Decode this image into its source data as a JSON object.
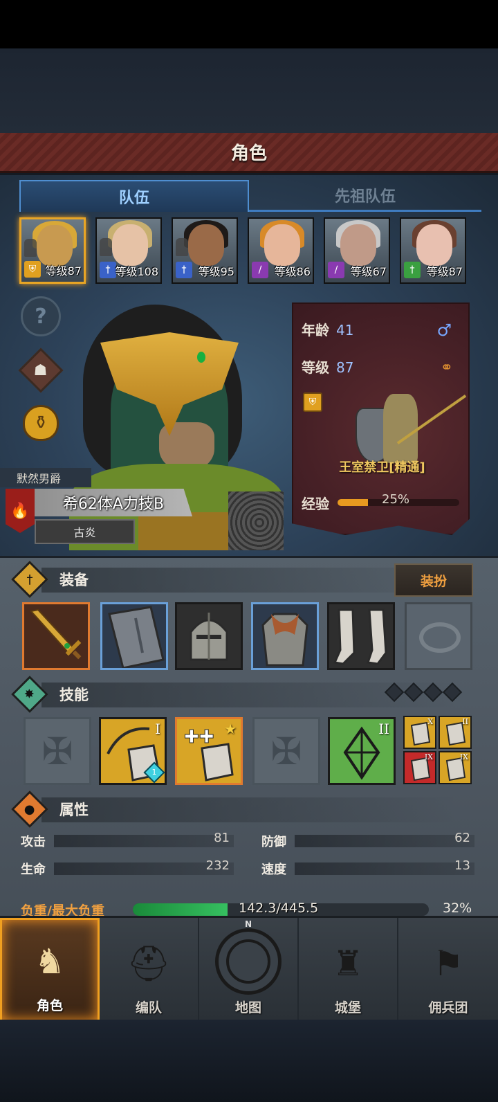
{
  "header": {
    "title": "角色"
  },
  "tabs": [
    {
      "label": "队伍",
      "active": true
    },
    {
      "label": "先祖队伍",
      "active": false
    }
  ],
  "party": [
    {
      "level_text": "等级87",
      "selected": true,
      "class_icon": "shield-star-icon",
      "class_color": "#e0a020",
      "skin": "#c89a50",
      "hair": "#d8a838"
    },
    {
      "level_text": "等级108",
      "selected": false,
      "class_icon": "sword-star-icon",
      "class_color": "#3a62c8",
      "skin": "#e6c2a6",
      "hair": "#c8b070"
    },
    {
      "level_text": "等级95",
      "selected": false,
      "class_icon": "sword-star-icon",
      "class_color": "#3a62c8",
      "skin": "#9a6a48",
      "hair": "#1e1a18"
    },
    {
      "level_text": "等级86",
      "selected": false,
      "class_icon": "staff-icon",
      "class_color": "#8a3ab0",
      "skin": "#e6b69a",
      "hair": "#d88a28"
    },
    {
      "level_text": "等级67",
      "selected": false,
      "class_icon": "staff-icon",
      "class_color": "#8a3ab0",
      "skin": "#c09a88",
      "hair": "#c8c8c8"
    },
    {
      "level_text": "等级87",
      "selected": false,
      "class_icon": "sword-star-icon",
      "class_color": "#3aa040",
      "skin": "#e8c0b0",
      "hair": "#6a4030"
    }
  ],
  "side_buttons": {
    "help_glyph": "?"
  },
  "hero": {
    "title": "默然男爵",
    "stat_summary": "希62体A力技B",
    "trait": "古炎"
  },
  "info_card": {
    "age_label": "年龄",
    "age_value": "41",
    "level_label": "等级",
    "level_value": "87",
    "gender_icon": "♂",
    "rings_icon": "rings-icon",
    "unit_name": "王室禁卫[精通]",
    "exp_label": "经验",
    "exp_percent": 0.25,
    "exp_text": "25%"
  },
  "equipment": {
    "title": "装备",
    "dress_button": "装扮",
    "slots": [
      {
        "name": "sword",
        "border": "orange"
      },
      {
        "name": "shield",
        "border": "blue"
      },
      {
        "name": "helmet",
        "border": "dark"
      },
      {
        "name": "armor",
        "border": "blue"
      },
      {
        "name": "boots",
        "border": "dark"
      },
      {
        "name": "ring",
        "border": "empty"
      }
    ]
  },
  "skills": {
    "title": "技能",
    "slots": [
      {
        "type": "empty"
      },
      {
        "type": "gold",
        "roman": "I",
        "gem": "1"
      },
      {
        "type": "gold-selected",
        "roman": "★"
      },
      {
        "type": "empty"
      },
      {
        "type": "green",
        "roman": "II"
      }
    ],
    "passives": [
      {
        "roman": "X",
        "color": "#d8a526"
      },
      {
        "roman": "II",
        "color": "#d8a526"
      },
      {
        "roman": "IX",
        "color": "#c42a2a"
      },
      {
        "roman": "IX",
        "color": "#d8a526"
      }
    ]
  },
  "attributes": {
    "title": "属性",
    "attack_label": "攻击",
    "attack_value": "81",
    "defense_label": "防御",
    "defense_value": "62",
    "hp_label": "生命",
    "hp_value": "232",
    "speed_label": "速度",
    "speed_value": "13",
    "load_label": "负重/最大负重",
    "load_text": "142.3/445.5",
    "load_fraction": 0.32,
    "load_percent": "32%"
  },
  "nav": [
    {
      "label": "角色",
      "active": true
    },
    {
      "label": "编队",
      "active": false
    },
    {
      "label": "地图",
      "active": false,
      "compass_n": "N"
    },
    {
      "label": "城堡",
      "active": false
    },
    {
      "label": "佣兵团",
      "active": false
    }
  ]
}
